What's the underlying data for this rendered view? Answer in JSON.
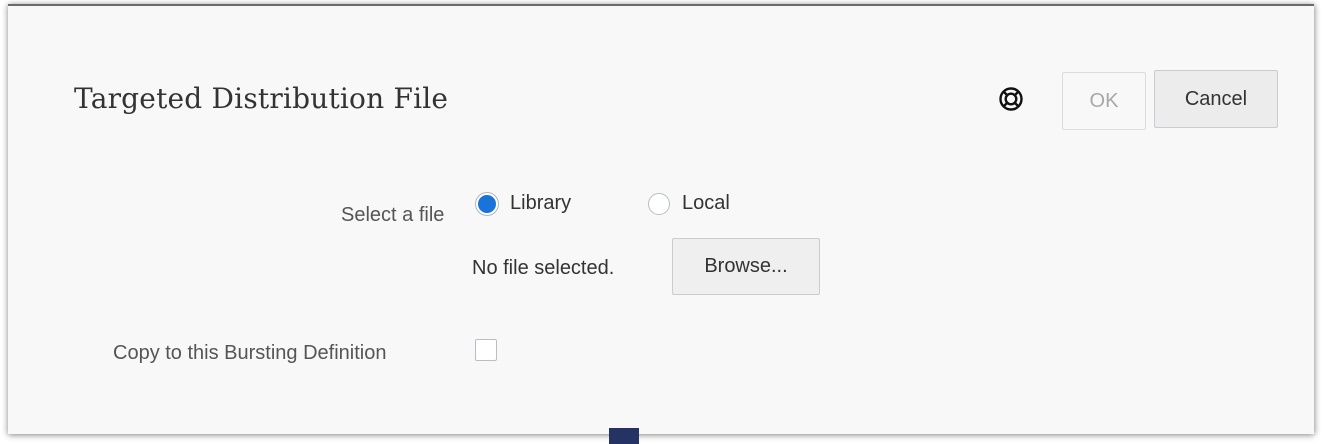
{
  "dialog": {
    "title": "Targeted Distribution File",
    "help_icon": "lifebuoy-help-icon",
    "ok_label": "OK",
    "cancel_label": "Cancel"
  },
  "file_selection": {
    "label": "Select a file",
    "options": [
      {
        "label": "Library",
        "selected": true
      },
      {
        "label": "Local",
        "selected": false
      }
    ],
    "status_text": "No file selected.",
    "browse_label": "Browse..."
  },
  "copy_option": {
    "label": "Copy to this Bursting Definition",
    "checked": false
  },
  "colors": {
    "accent": "#1a73d9",
    "dialog_background": "#f8f8f8",
    "disabled_text": "#a8a8a8"
  }
}
